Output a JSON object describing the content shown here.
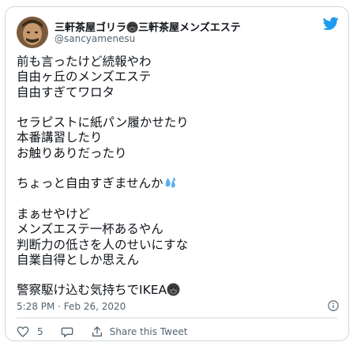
{
  "user": {
    "display_name": "三軒茶屋ゴリラ🦍三軒茶屋メンズエステ",
    "handle": "@sancyamenesu"
  },
  "tweet": {
    "lines": [
      "前も言ったけど続報やわ",
      "自由ヶ丘のメンズエステ",
      "自由すぎてワロタ",
      "",
      "セラピストに紙パン履かせたり",
      "本番講習したり",
      "お触りありだったり",
      "",
      "ちょっと自由すぎませんか💦",
      "",
      "まぁせやけど",
      "メンズエステ一杯あるやん",
      "判断力の低さを人のせいにすな",
      "自業自得としか思えん",
      "",
      "警察駆け込む気持ちでIKEA🦍"
    ],
    "line1": "前も言ったけど続報やわ",
    "line2": "自由ヶ丘のメンズエステ",
    "line3": "自由すぎてワロタ",
    "line5": "セラピストに紙パン履かせたり",
    "line6": "本番講習したり",
    "line7": "お触りありだったり",
    "line9_text": "ちょっと自由すぎませんか",
    "line11": "まぁせやけど",
    "line12": "メンズエステ一杯あるやん",
    "line13": "判断力の低さを人のせいにすな",
    "line14": "自業自得としか思えん",
    "line16_text": "警察駆け込む気持ちでIKEA"
  },
  "header": {
    "name_text": "三軒茶屋ゴリラ",
    "name_text2": "三軒茶屋メンズエステ"
  },
  "timestamp": "5:28 PM · Feb 26, 2020",
  "actions": {
    "like_count": "5",
    "share_label": "Share this Tweet"
  },
  "icons": {
    "brand": "twitter-bird-icon",
    "gorilla": "gorilla-emoji-icon",
    "sweat": "sweat-droplets-emoji-icon",
    "info": "info-icon",
    "like": "heart-icon",
    "reply": "comment-icon",
    "share": "share-icon"
  },
  "colors": {
    "twitter_blue": "#1d9bf0",
    "text": "#0f1419",
    "secondary": "#536471",
    "border": "#cfd9de"
  }
}
